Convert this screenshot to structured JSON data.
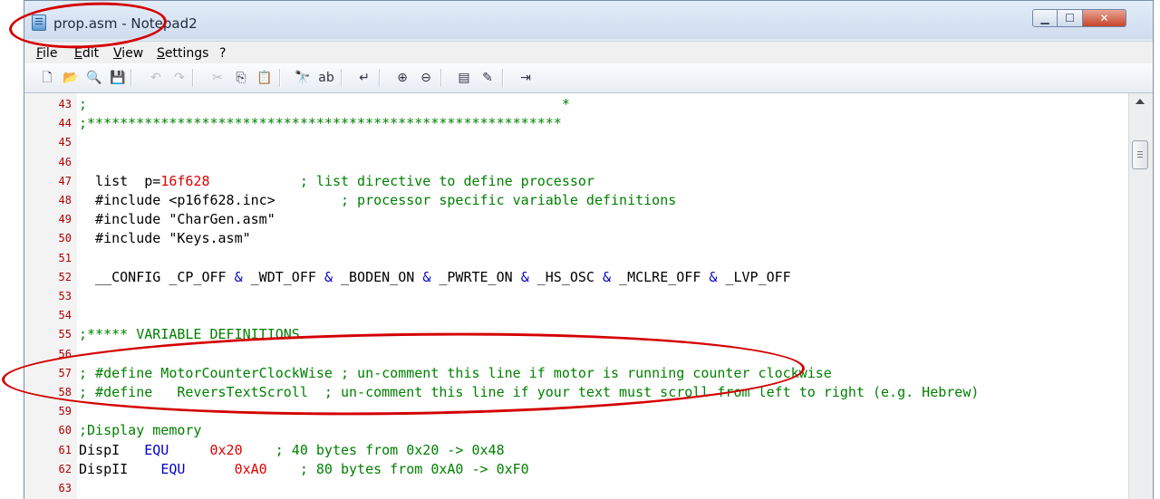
{
  "window": {
    "title": "prop.asm - Notepad2",
    "controls": {
      "minimize": "▁",
      "maximize": "☐",
      "close": "✕"
    }
  },
  "menu": [
    "File",
    "Edit",
    "View",
    "Settings",
    "?"
  ],
  "toolbar": {
    "icons": [
      {
        "name": "new-file-icon",
        "glyph": "🗋",
        "enabled": true
      },
      {
        "name": "open-file-icon",
        "glyph": "📂",
        "enabled": true
      },
      {
        "name": "browse-icon",
        "glyph": "🔍",
        "enabled": true
      },
      {
        "name": "save-icon",
        "glyph": "💾",
        "enabled": true
      },
      {
        "name": "undo-icon",
        "glyph": "↶",
        "enabled": false
      },
      {
        "name": "redo-icon",
        "glyph": "↷",
        "enabled": false
      },
      {
        "name": "cut-icon",
        "glyph": "✂",
        "enabled": false
      },
      {
        "name": "copy-icon",
        "glyph": "⎘",
        "enabled": true
      },
      {
        "name": "paste-icon",
        "glyph": "📋",
        "enabled": true
      },
      {
        "name": "find-icon",
        "glyph": "🔭",
        "enabled": true
      },
      {
        "name": "replace-icon",
        "glyph": "ab",
        "enabled": true
      },
      {
        "name": "word-wrap-icon",
        "glyph": "↵",
        "enabled": true
      },
      {
        "name": "zoom-in-icon",
        "glyph": "⊕",
        "enabled": true
      },
      {
        "name": "zoom-out-icon",
        "glyph": "⊖",
        "enabled": true
      },
      {
        "name": "scheme-icon",
        "glyph": "▤",
        "enabled": true
      },
      {
        "name": "scheme-config-icon",
        "glyph": "✎",
        "enabled": true
      },
      {
        "name": "exit-icon",
        "glyph": "⇥",
        "enabled": true
      }
    ]
  },
  "editor": {
    "lines": [
      {
        "n": "43",
        "segments": [
          {
            "t": ";                                                          *",
            "c": "green"
          }
        ]
      },
      {
        "n": "44",
        "segments": [
          {
            "t": ";**********************************************************",
            "c": "green"
          }
        ]
      },
      {
        "n": "45",
        "segments": []
      },
      {
        "n": "46",
        "segments": []
      },
      {
        "n": "47",
        "segments": [
          {
            "t": "  list  p=",
            "c": "black"
          },
          {
            "t": "16f628",
            "c": "red"
          },
          {
            "t": "           ; list directive to define processor",
            "c": "green"
          }
        ]
      },
      {
        "n": "48",
        "segments": [
          {
            "t": "  #include <p16f628.inc>",
            "c": "black"
          },
          {
            "t": "        ; processor specific variable definitions",
            "c": "green"
          }
        ]
      },
      {
        "n": "49",
        "segments": [
          {
            "t": "  #include \"CharGen.asm\"",
            "c": "black"
          }
        ]
      },
      {
        "n": "50",
        "segments": [
          {
            "t": "  #include \"Keys.asm\"",
            "c": "black"
          }
        ]
      },
      {
        "n": "51",
        "segments": []
      },
      {
        "n": "52",
        "segments": [
          {
            "t": "  __CONFIG _CP_OFF ",
            "c": "black"
          },
          {
            "t": "&",
            "c": "blue"
          },
          {
            "t": " _WDT_OFF ",
            "c": "black"
          },
          {
            "t": "&",
            "c": "blue"
          },
          {
            "t": " _BODEN_ON ",
            "c": "black"
          },
          {
            "t": "&",
            "c": "blue"
          },
          {
            "t": " _PWRTE_ON ",
            "c": "black"
          },
          {
            "t": "&",
            "c": "blue"
          },
          {
            "t": " _HS_OSC ",
            "c": "black"
          },
          {
            "t": "&",
            "c": "blue"
          },
          {
            "t": " _MCLRE_OFF ",
            "c": "black"
          },
          {
            "t": "&",
            "c": "blue"
          },
          {
            "t": " _LVP_OFF",
            "c": "black"
          }
        ]
      },
      {
        "n": "53",
        "segments": []
      },
      {
        "n": "54",
        "segments": []
      },
      {
        "n": "55",
        "segments": [
          {
            "t": ";***** VARIABLE DEFINITIONS",
            "c": "green"
          }
        ]
      },
      {
        "n": "56",
        "segments": []
      },
      {
        "n": "57",
        "segments": [
          {
            "t": "; #define MotorCounterClockWise ; un-comment this line if motor is running counter clockwise",
            "c": "green"
          }
        ]
      },
      {
        "n": "58",
        "segments": [
          {
            "t": "; #define   ReversTextScroll  ; un-comment this line if your text must scroll from left to right (e.g. Hebrew)",
            "c": "green"
          }
        ]
      },
      {
        "n": "59",
        "segments": []
      },
      {
        "n": "60",
        "segments": [
          {
            "t": ";Display memory",
            "c": "green"
          }
        ]
      },
      {
        "n": "61",
        "segments": [
          {
            "t": "DispI   ",
            "c": "black"
          },
          {
            "t": "EQU",
            "c": "blue"
          },
          {
            "t": "     ",
            "c": "black"
          },
          {
            "t": "0x20",
            "c": "red"
          },
          {
            "t": "    ; 40 bytes from 0x20 -> 0x48",
            "c": "green"
          }
        ]
      },
      {
        "n": "62",
        "segments": [
          {
            "t": "DispII    ",
            "c": "black"
          },
          {
            "t": "EQU",
            "c": "blue"
          },
          {
            "t": "      ",
            "c": "black"
          },
          {
            "t": "0xA0",
            "c": "red"
          },
          {
            "t": "    ; 80 bytes from 0xA0 -> 0xF0",
            "c": "green"
          }
        ]
      },
      {
        "n": "63",
        "segments": []
      }
    ]
  }
}
